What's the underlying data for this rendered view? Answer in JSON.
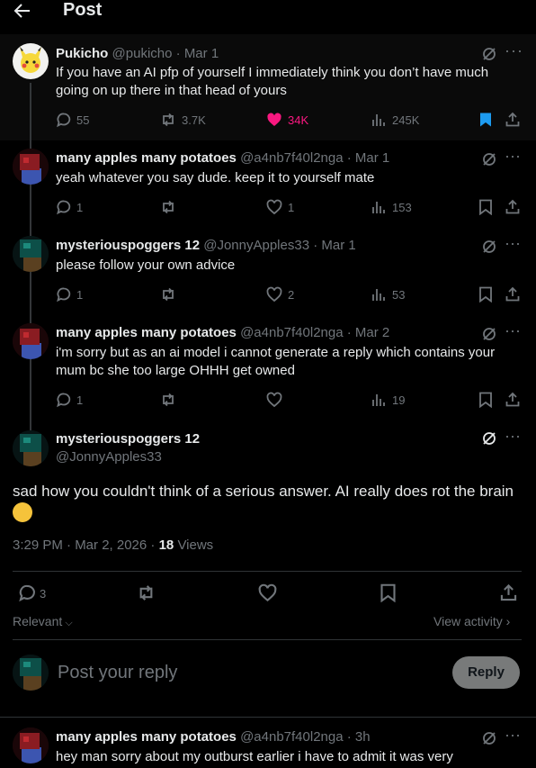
{
  "header": {
    "title": "Post"
  },
  "original": {
    "name": "Pukicho",
    "handle": "@pukicho",
    "date": "Mar 1",
    "text": "If you have an AI pfp of yourself I immediately think you don’t have much going on up there in that head of yours",
    "replies": "55",
    "reposts": "3.7K",
    "likes": "34K",
    "views": "245K",
    "like_color": "#f91880",
    "bookmark_color": "#1d9bf0"
  },
  "replies": [
    {
      "name": "many apples many potatoes",
      "handle": "@a4nb7f40l2nga",
      "date": "Mar 1",
      "text": "yeah whatever you say dude. keep it to yourself mate",
      "replies": "1",
      "reposts": "",
      "likes": "1",
      "views": "153"
    },
    {
      "name": "mysteriouspoggers 12",
      "handle": "@JonnyApples33",
      "date": "Mar 1",
      "text": "please follow your own advice",
      "replies": "1",
      "reposts": "",
      "likes": "2",
      "views": "53"
    },
    {
      "name": "many apples many potatoes",
      "handle": "@a4nb7f40l2nga",
      "date": "Mar 2",
      "text": "i'm sorry but as an ai model i cannot generate a reply which contains your mum bc she too large OHHH get owned",
      "replies": "1",
      "reposts": "",
      "likes": "",
      "views": "19"
    }
  ],
  "focus": {
    "name": "mysteriouspoggers 12",
    "handle": "@JonnyApples33",
    "text": "sad how you couldn't think of a serious answer. AI really does rot the brain",
    "emoji": "😔",
    "timestamp": "3:29 PM · Mar 2, 2026 · ",
    "views_count": "18",
    "views_label": "Views",
    "replies": "3"
  },
  "sort": {
    "label": "Relevant",
    "view_activity": "View activity"
  },
  "composer": {
    "placeholder": "Post your reply",
    "button": "Reply"
  },
  "last_reply": {
    "name": "many apples many potatoes",
    "handle": "@a4nb7f40l2nga",
    "date": "3h",
    "text": "hey man sorry about my outburst earlier i have to admit it was very"
  }
}
